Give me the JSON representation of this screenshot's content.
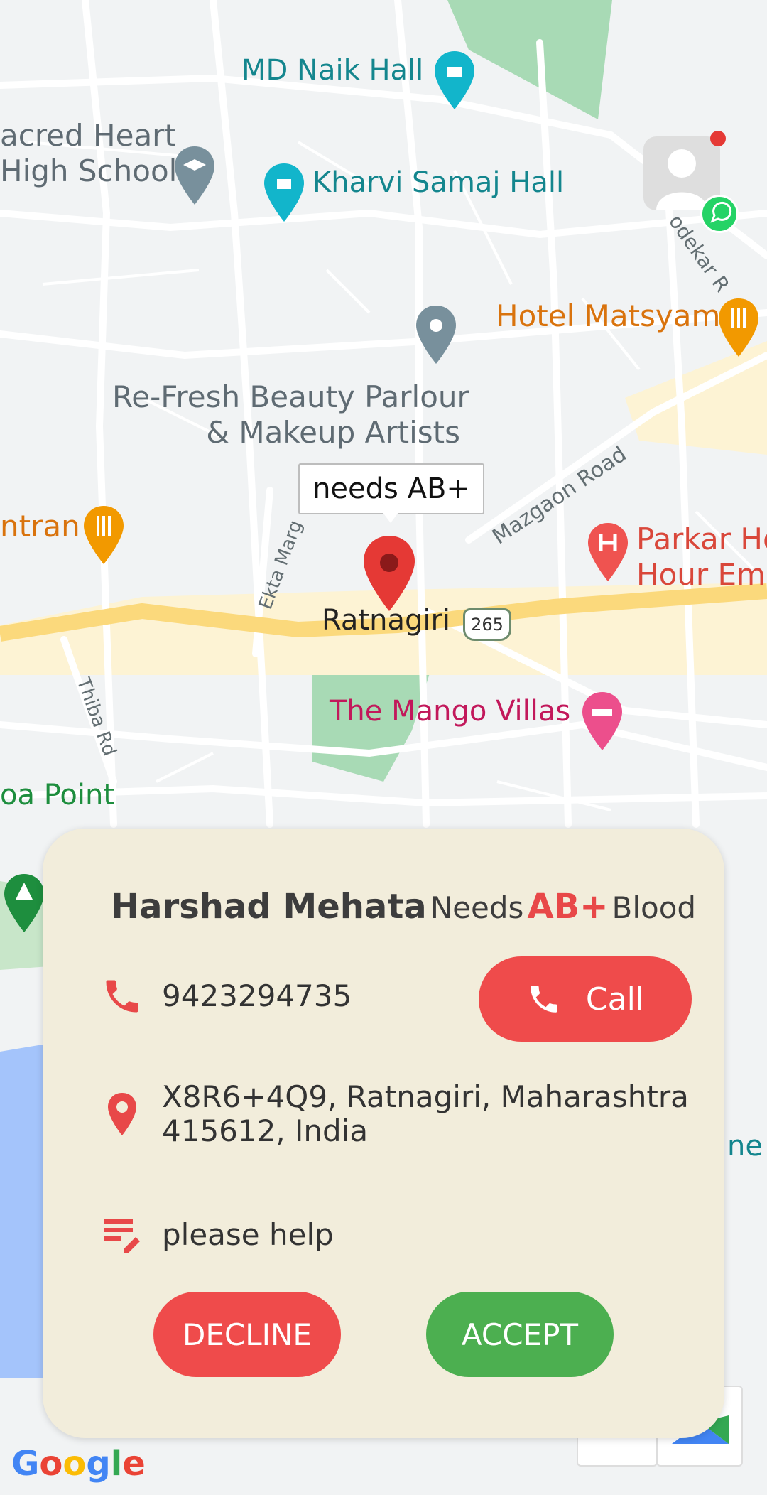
{
  "map": {
    "callout": "needs AB+",
    "city": "Ratnagiri",
    "highway": "265",
    "pois": {
      "md_naik_hall": "MD Naik Hall",
      "sacred_heart_1": "acred Heart",
      "sacred_heart_2": "High School",
      "kharvi_samaj_hall": "Kharvi Samaj Hall",
      "hotel_matsyam": "Hotel Matsyam",
      "refresh_1": "Re-Fresh Beauty Parlour",
      "refresh_2": "& Makeup Artists",
      "restaurant_left": "ntran",
      "parkar_1": "Parkar Ho",
      "parkar_2": "Hour Eme",
      "mango_villas": "The Mango Villas",
      "point_left": "oa Point",
      "right_edge_partial": "ne S"
    },
    "roads": {
      "mazgaon": "Mazgaon Road",
      "ekta": "Ekta Marg",
      "thiba": "Thiba Rd",
      "odekar": "odekar R"
    },
    "google_logo": [
      "G",
      "o",
      "o",
      "g",
      "l",
      "e"
    ],
    "colors": {
      "water": "#a4c4fb",
      "park": "#a8dab5",
      "highway": "#fbd97c",
      "road": "#ffffff"
    }
  },
  "request": {
    "name": "Harshad Mehata",
    "needs_label": "Needs",
    "blood_group": "AB+",
    "blood_label": "Blood",
    "phone": "9423294735",
    "call_label": "Call",
    "address_line1": "X8R6+4Q9, Ratnagiri, Maharashtra",
    "address_line2": "415612, India",
    "note": "please help",
    "decline_label": "DECLINE",
    "accept_label": "ACCEPT",
    "accent_color": "#ef4b4b",
    "accept_color": "#4caf50",
    "card_color": "#f2eddb"
  }
}
